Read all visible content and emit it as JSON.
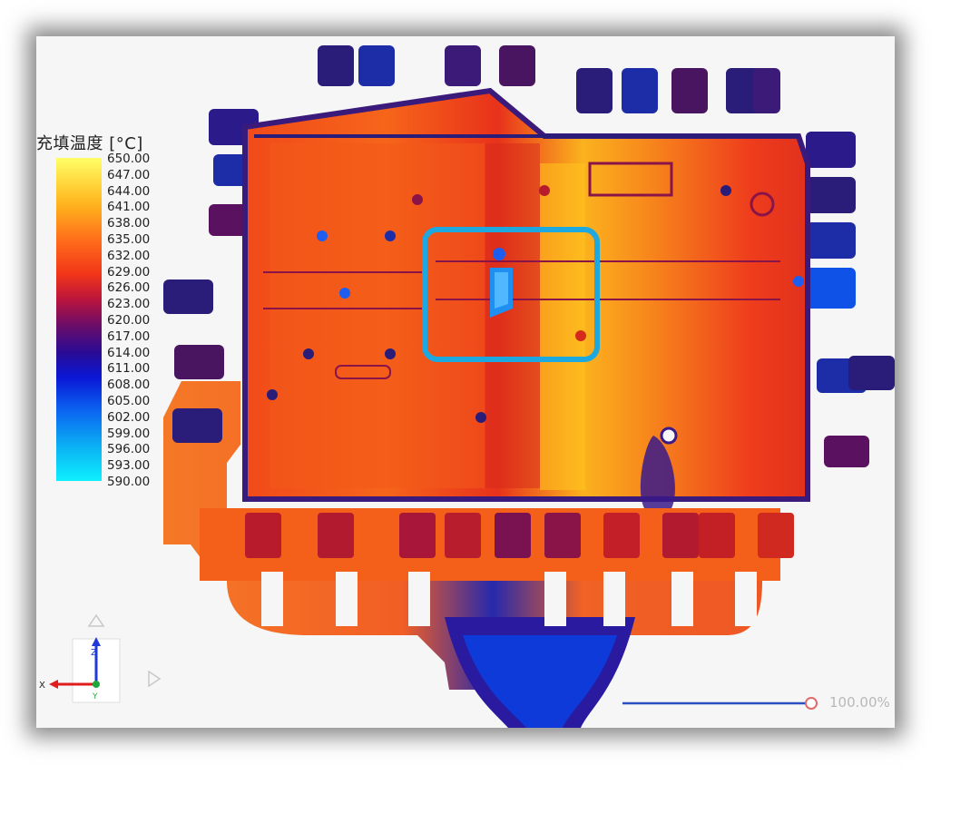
{
  "legend": {
    "title": "充填温度 [°C]",
    "ticks": [
      "650.00",
      "647.00",
      "644.00",
      "641.00",
      "638.00",
      "635.00",
      "632.00",
      "629.00",
      "626.00",
      "623.00",
      "620.00",
      "617.00",
      "614.00",
      "611.00",
      "608.00",
      "605.00",
      "602.00",
      "599.00",
      "596.00",
      "593.00",
      "590.00"
    ]
  },
  "axes": {
    "x_label": "X",
    "y_label": "Y",
    "z_label": "Z"
  },
  "zoom": {
    "value": "100.00%",
    "fraction": 1.0
  },
  "colors": {
    "highlight_box": "#1ea8e0",
    "scale_hot": "#ffff66",
    "scale_mid": "#f23519",
    "scale_cold": "#0ef0ff"
  }
}
